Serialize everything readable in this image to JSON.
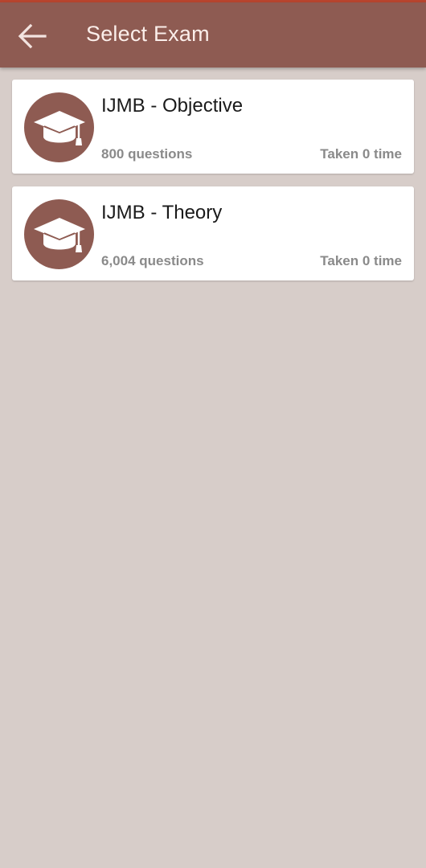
{
  "appbar": {
    "title": "Select Exam",
    "back_icon": "arrow-left-icon",
    "color": "#8e5b52"
  },
  "exams": [
    {
      "name": "IJMB - Objective",
      "questions": "800 questions",
      "taken": "Taken 0 time",
      "icon": "graduation-cap-icon"
    },
    {
      "name": "IJMB - Theory",
      "questions": "6,004 questions",
      "taken": "Taken 0 time",
      "icon": "graduation-cap-icon"
    }
  ],
  "colors": {
    "background": "#d7cdc9",
    "accent": "#8e5b52",
    "card": "#ffffff",
    "muted_text": "#8a8a8a"
  }
}
